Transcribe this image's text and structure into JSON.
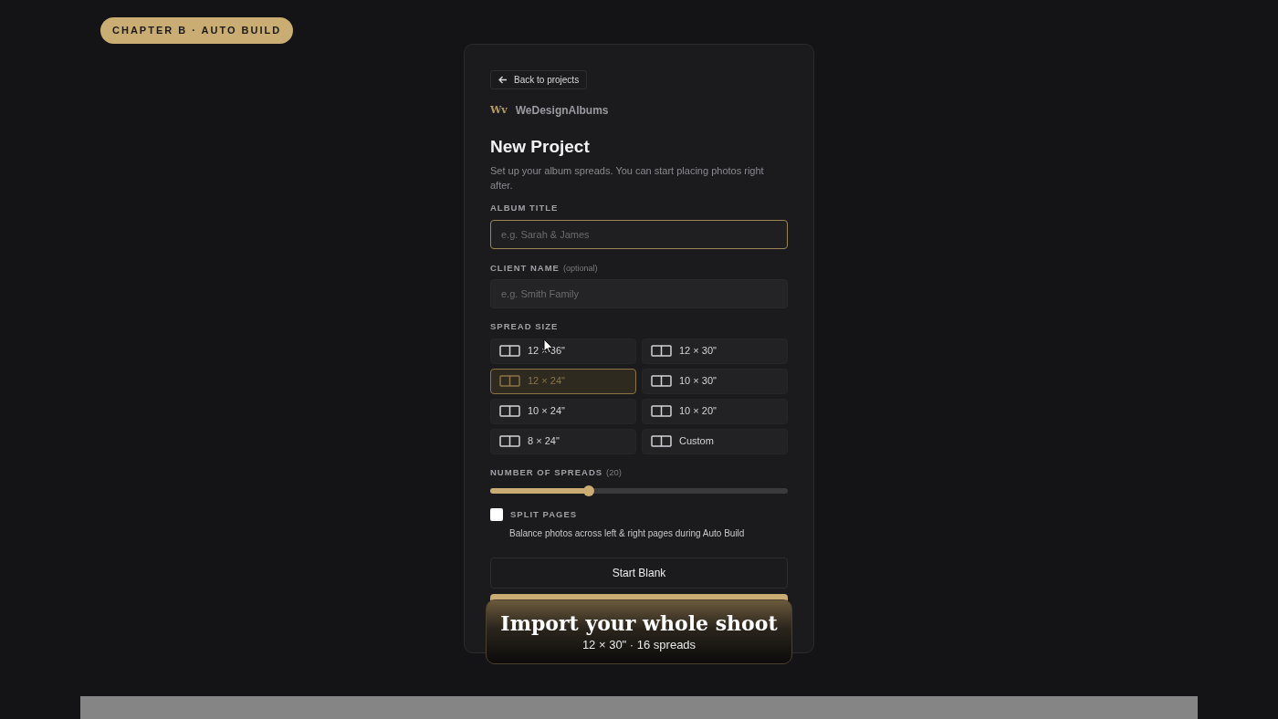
{
  "chapter_badge": "CHAPTER B · AUTO BUILD",
  "back_link": "Back to projects",
  "brand": {
    "logo": "Wv",
    "name": "WeDesignAlbums"
  },
  "title": "New Project",
  "subtitle": "Set up your album spreads. You can start placing photos right after.",
  "album_title": {
    "label": "ALBUM TITLE",
    "placeholder": "e.g. Sarah & James",
    "focused": true
  },
  "client_name": {
    "label": "CLIENT NAME",
    "hint": "(optional)",
    "placeholder": "e.g. Smith Family",
    "focused": false
  },
  "spread_size": {
    "label": "SPREAD SIZE",
    "options": [
      {
        "label": "12 × 36\"",
        "selected": false
      },
      {
        "label": "12 × 30\"",
        "selected": false
      },
      {
        "label": "12 × 24\"",
        "selected": true
      },
      {
        "label": "10 × 30\"",
        "selected": false
      },
      {
        "label": "10 × 24\"",
        "selected": false
      },
      {
        "label": "10 × 20\"",
        "selected": false
      },
      {
        "label": "8 × 24\"",
        "selected": false
      },
      {
        "label": "Custom",
        "selected": false
      }
    ]
  },
  "spreads": {
    "label": "NUMBER OF SPREADS",
    "count": "(20)",
    "level": 0.33
  },
  "split_pages": {
    "label": "SPLIT PAGES",
    "description": "Balance photos across left & right pages during Auto Build",
    "checked": false
  },
  "start_blank": "Start Blank",
  "caption": {
    "title": "Import your whole shoot",
    "subtitle": "12 × 30\" · 16 spreads"
  }
}
